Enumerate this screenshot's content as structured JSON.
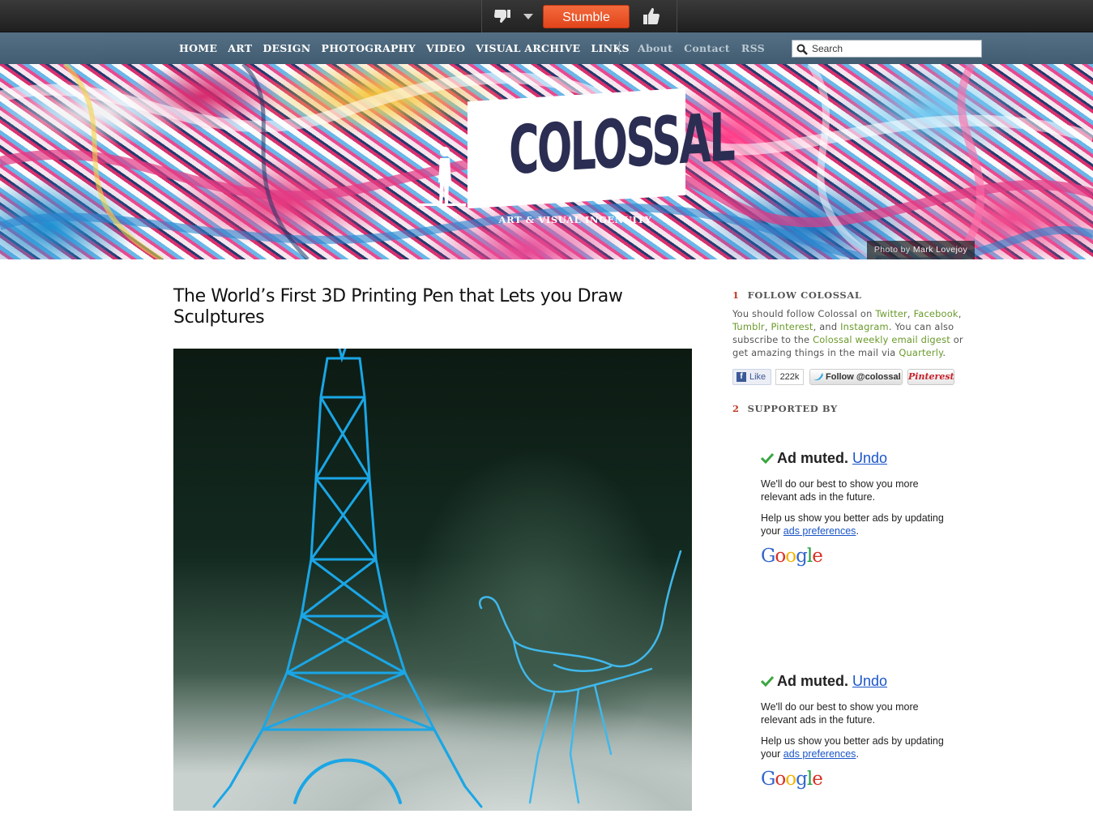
{
  "stumblebar": {
    "stumble_label": "Stumble"
  },
  "nav": {
    "primary": [
      "HOME",
      "ART",
      "DESIGN",
      "PHOTOGRAPHY",
      "VIDEO",
      "VISUAL ARCHIVE",
      "LINKS"
    ],
    "secondary": [
      "About",
      "Contact",
      "RSS"
    ],
    "search_placeholder": "Search"
  },
  "hero": {
    "logo_text": "COLOSSAL",
    "tagline": "ART & VISUAL INGENUITY",
    "photo_credit_prefix": "Photo by ",
    "photo_credit_name": "Mark Lovejoy"
  },
  "article": {
    "title": "The World’s First 3D Printing Pen that Lets you Draw Sculptures"
  },
  "sidebar": {
    "follow": {
      "number": "1",
      "heading": "FOLLOW COLOSSAL",
      "text_1": "You should follow Colossal on ",
      "twitter": "Twitter",
      "comma_1": ", ",
      "facebook": "Facebook",
      "comma_2": ", ",
      "tumblr": "Tumblr",
      "comma_3": ", ",
      "pinterest": "Pinterest",
      "and": ", and ",
      "instagram": "Instagram",
      "text_2": ". You can also subscribe to the ",
      "digest": "Colossal weekly email digest",
      "text_3": " or get amazing things in the mail via ",
      "quarterly": "Quarterly",
      "text_4": "."
    },
    "social": {
      "like_label": "Like",
      "like_count": "222k",
      "follow_label": "Follow @colossal",
      "pinterest_label": "Pinterest"
    },
    "supported": {
      "number": "2",
      "heading": "SUPPORTED BY"
    },
    "ads": [
      {
        "muted": "Ad muted.",
        "undo": "Undo",
        "line1": "We'll do our best to show you more relevant ads in the future.",
        "line2_prefix": "Help us show you better ads by updating your ",
        "prefs_link": "ads preferences",
        "line2_suffix": ".",
        "brand": "Google"
      },
      {
        "muted": "Ad muted.",
        "undo": "Undo",
        "line1": "We'll do our best to show you more relevant ads in the future.",
        "line2_prefix": "Help us show you better ads by updating your ",
        "prefs_link": "ads preferences",
        "line2_suffix": ".",
        "brand": "Google"
      }
    ]
  },
  "colors": {
    "accent_orange": "#e2451b",
    "nav_blue": "#3f5b71",
    "link_green": "#6a9a2a",
    "heading_number_red": "#c03a22",
    "google_link_blue": "#1a55c8"
  }
}
